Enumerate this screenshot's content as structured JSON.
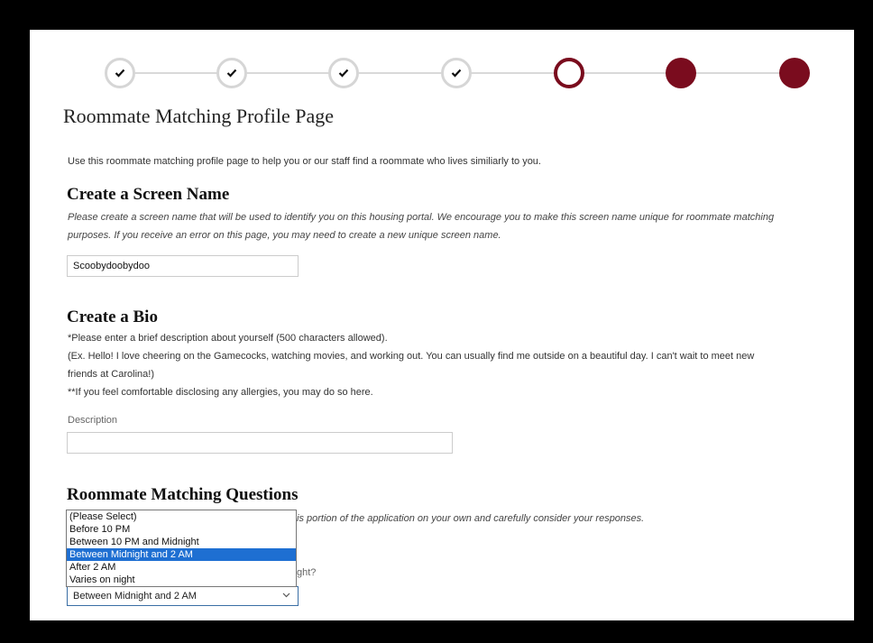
{
  "page": {
    "title": "Roommate Matching Profile Page",
    "intro": "Use this roommate matching profile page to help you or our staff find a roommate who lives similiarly to you."
  },
  "stepper": {
    "steps": [
      {
        "state": "complete",
        "icon": "check-icon"
      },
      {
        "state": "complete",
        "icon": "check-icon"
      },
      {
        "state": "complete",
        "icon": "check-icon"
      },
      {
        "state": "complete",
        "icon": "check-icon"
      },
      {
        "state": "current"
      },
      {
        "state": "upcoming"
      },
      {
        "state": "upcoming"
      }
    ],
    "accent_color": "#7a0c1e"
  },
  "screen_name": {
    "heading": "Create a Screen Name",
    "help_line1": "Please create a screen name that will be used to identify you on this housing portal. We encourage you to make this screen name unique for roommate matching",
    "help_line2": "purposes. If you receive an error on this page, you may need to create a new unique screen name.",
    "value": "Scoobydoobydoo"
  },
  "bio": {
    "heading": "Create a Bio",
    "line1": "*Please enter a brief description about yourself (500 characters allowed).",
    "line2": "(Ex. Hello! I love cheering on the Gamecocks, watching movies, and working out. You can usually find me outside on a beautiful day. I can't wait to meet new",
    "line3": "friends at Carolina!)",
    "line4": "**If you feel comfortable disclosing any allergies, you may do so here.",
    "description_label": "Description",
    "description_value": ""
  },
  "questions": {
    "heading": "Roommate Matching Questions",
    "help_fragment": "is portion of the application on your own and carefully consider your responses.",
    "question_fragment": "ght?",
    "select_value": "Between Midnight and 2 AM",
    "options": [
      "(Please Select)",
      "Before 10 PM",
      "Between 10 PM and Midnight",
      "Between Midnight and 2 AM",
      "After 2 AM",
      "Varies on night"
    ],
    "selected_index": 3
  }
}
